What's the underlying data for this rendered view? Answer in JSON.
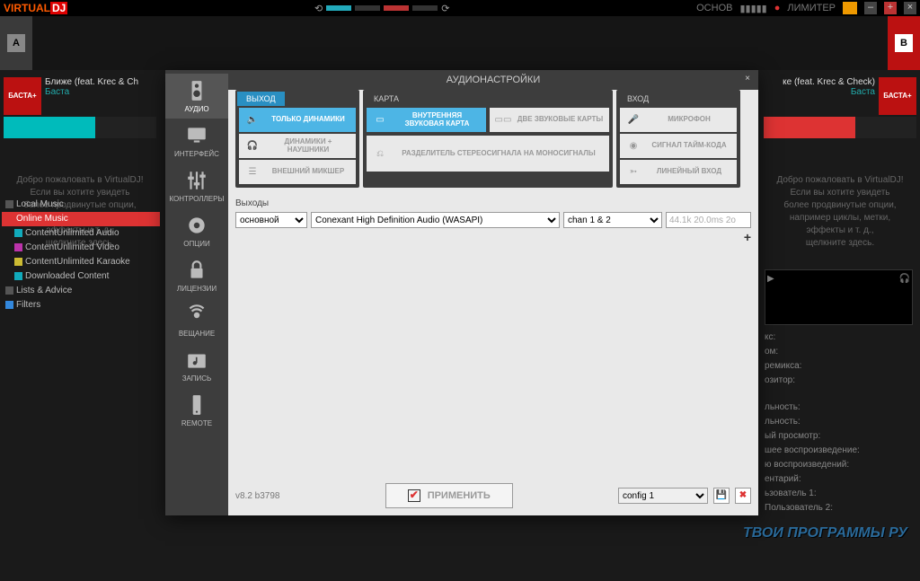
{
  "app": {
    "logo_a": "VIRTUAL",
    "logo_b": "DJ",
    "ochob": "ОСНОВ",
    "limiter": "ЛИМИТЕР"
  },
  "deckA": {
    "badge": "A",
    "cover": "БАСТА+",
    "title": "Ближе (feat. Krec & Ch",
    "artist": "Баста",
    "welcome": "Добро пожаловать в VirtualDJ!\nЕсли вы хотите увидеть\nболее продвинутые опции,\nнапример циклы, метки,\nэффекты и т. д.,\nщелкните здесь."
  },
  "deckB": {
    "badge": "B",
    "cover": "БАСТА+",
    "title": "ке (feat. Krec & Check)",
    "artist": "Баста",
    "welcome": "Добро пожаловать в VirtualDJ!\nЕсли вы хотите увидеть\nболее продвинутые опции,\nнапример циклы, метки,\nэффекты и т. д.,\nщелкните здесь."
  },
  "tree": {
    "items": [
      "Local Music",
      "Online Music",
      "ContentUnlimited Audio",
      "ContentUnlimited Video",
      "ContentUnlimited Karaoke",
      "Downloaded Content",
      "Lists & Advice",
      "Filters"
    ]
  },
  "info": {
    "rows": [
      "кс:",
      "ом:",
      "ремикса:",
      "озитор:",
      "льность:",
      "льность:",
      "ый просмотр:",
      "шее воспроизведение:",
      "ю воспроизведений:",
      "ентарий:",
      "ьзователь 1:",
      "Пользователь 2:"
    ]
  },
  "watermark": "ТВОИ ПРОГРАММЫ РУ",
  "dialog": {
    "title": "АУДИОНАСТРОЙКИ",
    "version": "v8.2 b3798",
    "nav": [
      "АУДИО",
      "ИНТЕРФЕЙС",
      "КОНТРОЛЛЕРЫ",
      "ОПЦИИ",
      "ЛИЦЕНЗИИ",
      "ВЕЩАНИЕ",
      "ЗАПИСЬ",
      "REMOTE"
    ],
    "groups": {
      "out": {
        "title": "ВЫХОД",
        "opts": [
          "ТОЛЬКО ДИНАМИКИ",
          "ДИНАМИКИ + НАУШНИКИ",
          "ВНЕШНИЙ МИКШЕР"
        ]
      },
      "card": {
        "title": "КАРТА",
        "row1": [
          "ВНУТРЕННЯЯ ЗВУКОВАЯ КАРТА",
          "ДВЕ ЗВУКОВЫЕ КАРТЫ"
        ],
        "row2": "РАЗДЕЛИТЕЛЬ СТЕРЕОСИГНАЛА НА МОНОСИГНАЛЫ"
      },
      "in": {
        "title": "ВХОД",
        "opts": [
          "МИКРОФОН",
          "СИГНАЛ ТАЙМ-КОДА",
          "ЛИНЕЙНЫЙ ВХОД"
        ]
      }
    },
    "outputs": {
      "label": "Выходы",
      "type": "основной",
      "device": "Conexant High Definition Audio (WASAPI)",
      "channels": "chan 1 & 2",
      "sample": "44.1k 20.0ms 2o"
    },
    "apply": "ПРИМЕНИТЬ",
    "config": "config 1"
  }
}
